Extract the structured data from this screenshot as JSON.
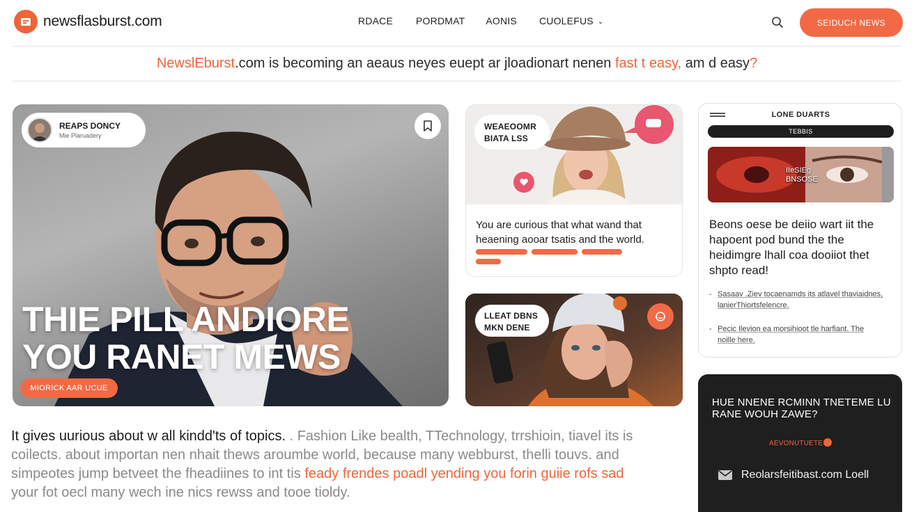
{
  "header": {
    "logo_text": "newsflasburst.com",
    "nav": [
      {
        "label": "RDACE"
      },
      {
        "label": "PORDMAT"
      },
      {
        "label": "AONIS"
      },
      {
        "label": "CUOLEFUS"
      }
    ],
    "cta_label": "SEIDUCH NEWS",
    "accent_color": "#f0643a"
  },
  "tagline": {
    "brand": "NewslEburst",
    "part1": ".com  is becoming an aeaus neyes euept ar jloadionart nenen ",
    "accent": "fast t easy,",
    "part2": " am d easy",
    "qmark": "?"
  },
  "hero": {
    "author_name": "REAPS DONCY",
    "author_sub": "Mie Plaruadery",
    "title_line1": "THIE PILL ANDIORE",
    "title_line2": "YOU RANET MEWS",
    "button_label": "MIORICK AAR UCUE"
  },
  "card1": {
    "pill_line1": "WEAEOOMR",
    "pill_line2": "BIATA LSS",
    "text_line1": "You are curious that what wand that",
    "text_line2": "heaening aooar tsatis and the world."
  },
  "card2": {
    "pill_line1": "LLEAT DBNS",
    "pill_line2": "MKN DENE"
  },
  "side": {
    "heading": "LONE DUARTS",
    "bar_label": "TEBBIS",
    "image_label_line1": "IIeSIEg",
    "image_label_line2": "BNSOSE",
    "text": "Beons oese be deiio wart iit the hapoent pod bund the the heidimgre lhall coa dooiiot thet shpto read!",
    "links": [
      {
        "line1": "Sasaav .Ziev tocaenamds its atlavel thaviaidnes,",
        "line2": "lanierThiortsfelencre."
      },
      {
        "line1": "Pecic Ilevion ea morsihioot tle harfiant. The",
        "line2": "noille here."
      }
    ]
  },
  "dark_card": {
    "title": "HUE NNENE RCMINN TNETEME LU RANE WOUH ZAWE?",
    "accent": "AEVONUTUETE",
    "email": "Reolarsfeitibast.com Loell"
  },
  "paragraph": {
    "line1_dark": "It gives uurious about w all kindd'ts of topics.",
    "line1_rest": " . Fashion Like bealth, TTechnology, trrshioin, tiavel its is",
    "line2": "coilects. about importan nen nhait thews aroumbe world, because many webburst, thelli touvs. and",
    "line3_pre": "simpeotes jump betveet the fheadiines to int tis ",
    "line3_accent": "feady frendes poadl yending you forin guiie rofs sad",
    "line4": "your fot oecl many wech ine nics rewss and tooe tioldy."
  }
}
